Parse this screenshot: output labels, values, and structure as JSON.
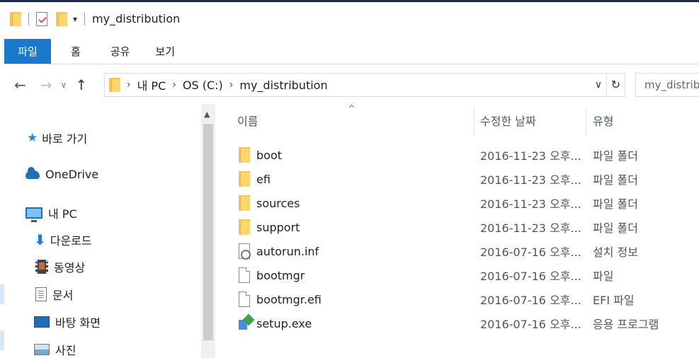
{
  "window": {
    "title": "my_distribution"
  },
  "ribbon": {
    "tabs": [
      "파일",
      "홈",
      "공유",
      "보기"
    ]
  },
  "address": {
    "crumbs": [
      "내 PC",
      "OS (C:)",
      "my_distribution"
    ],
    "search_placeholder": "my_distribu"
  },
  "nav": {
    "items": [
      {
        "label": "바로 가기",
        "icon": "star-icon"
      },
      {
        "label": "OneDrive",
        "icon": "onedrive-icon"
      },
      {
        "label": "내 PC",
        "icon": "pc-icon"
      },
      {
        "label": "다운로드",
        "icon": "download-icon"
      },
      {
        "label": "동영상",
        "icon": "videos-icon"
      },
      {
        "label": "문서",
        "icon": "documents-icon"
      },
      {
        "label": "바탕 화면",
        "icon": "desktop-icon"
      },
      {
        "label": "사진",
        "icon": "pictures-icon"
      }
    ]
  },
  "columns": {
    "name": "이름",
    "date": "수정한 날짜",
    "type": "유형"
  },
  "files": [
    {
      "name": "boot",
      "date": "2016-11-23 오후...",
      "type": "파일 폴더",
      "icon": "folder-icon"
    },
    {
      "name": "efi",
      "date": "2016-11-23 오후...",
      "type": "파일 폴더",
      "icon": "folder-icon"
    },
    {
      "name": "sources",
      "date": "2016-11-23 오후...",
      "type": "파일 폴더",
      "icon": "folder-icon"
    },
    {
      "name": "support",
      "date": "2016-11-23 오후...",
      "type": "파일 폴더",
      "icon": "folder-icon"
    },
    {
      "name": "autorun.inf",
      "date": "2016-07-16 오후...",
      "type": "설치 정보",
      "icon": "setup-info-icon"
    },
    {
      "name": "bootmgr",
      "date": "2016-07-16 오후...",
      "type": "파일",
      "icon": "file-icon"
    },
    {
      "name": "bootmgr.efi",
      "date": "2016-07-16 오후...",
      "type": "EFI 파일",
      "icon": "file-icon"
    },
    {
      "name": "setup.exe",
      "date": "2016-07-16 오후...",
      "type": "응용 프로그램",
      "icon": "setup-exe-icon"
    }
  ],
  "colors": {
    "file_tab": "#1979ca",
    "folder": "#ffd56e",
    "accent": "#1f6fb2"
  }
}
